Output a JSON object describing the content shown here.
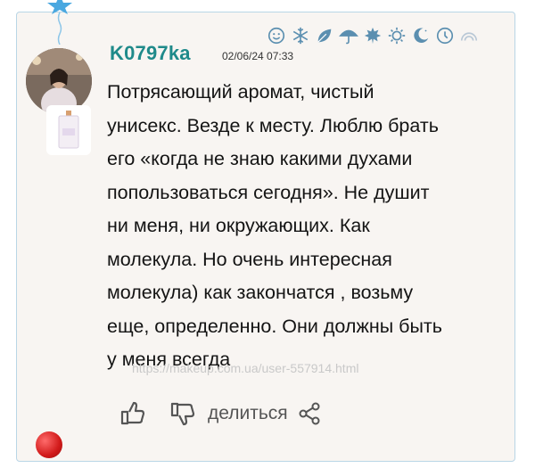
{
  "review": {
    "username": "K0797ka",
    "date": "02/06/24 07:33",
    "text": "Потрясающий аромат, чистый\nунисекс. Везде к месту. Люблю брать\nего «когда не знаю какими духами\nпопользоваться сегодня». Не душит\nни меня, ни окружающих. Как\nмолекула. Но очень интересная\nмолекула) как закончатся , возьму\nеще, определенно. Они должны быть\nу меня всегда",
    "watermark": "https://makeup.com.ua/user-557914.html"
  },
  "mood_icons": [
    "smile-icon",
    "snowflake-icon",
    "leaf-icon",
    "umbrella-icon",
    "maple-leaf-icon",
    "sun-icon",
    "moon-icon",
    "clock-icon",
    "rainbow-icon"
  ],
  "actions": {
    "share_label": "делиться",
    "icons": [
      "thumbs-up-icon",
      "thumbs-down-icon",
      "share-icon"
    ]
  },
  "colors": {
    "accent": "#1f8a8a",
    "icon": "#5b8fb0",
    "card_bg": "#f8f5f2",
    "card_border": "#b9d6e6"
  }
}
